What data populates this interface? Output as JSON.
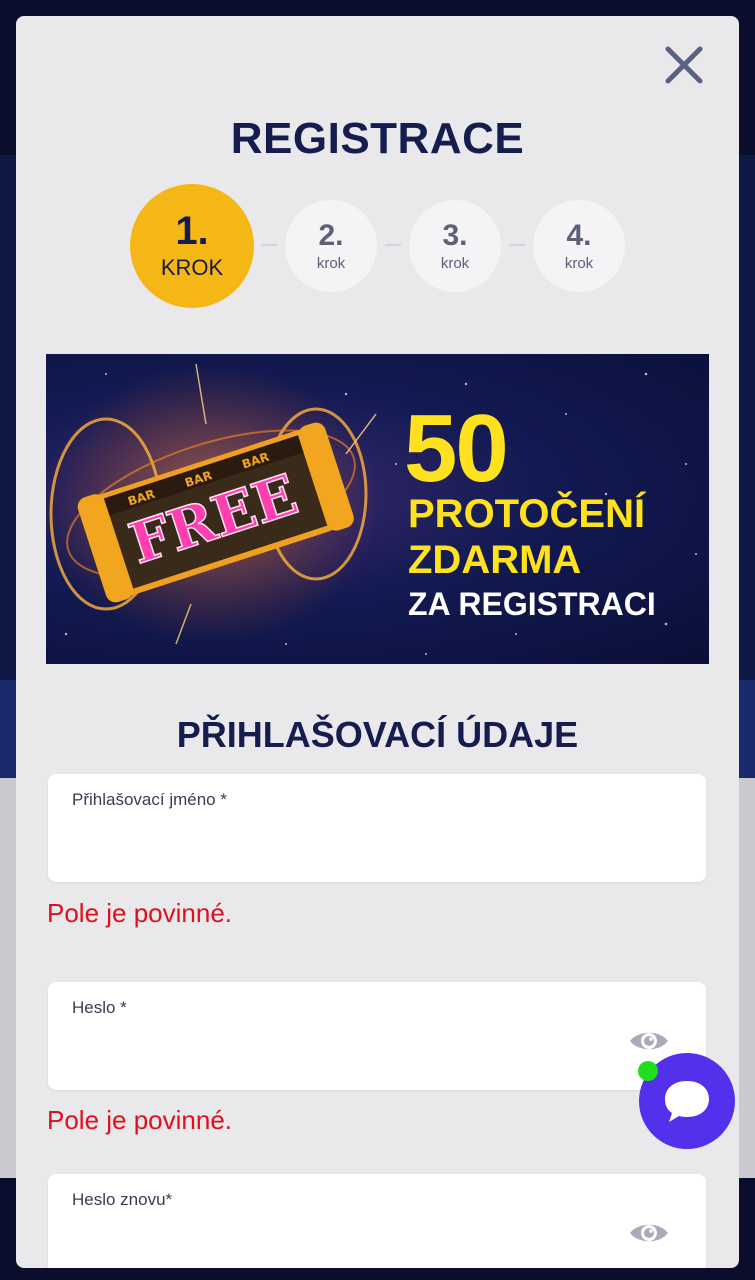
{
  "modal": {
    "title": "REGISTRACE",
    "close_icon": "close-icon"
  },
  "steps": [
    {
      "num": "1.",
      "label": "KROK",
      "active": true
    },
    {
      "num": "2.",
      "label": "krok",
      "active": false
    },
    {
      "num": "3.",
      "label": "krok",
      "active": false
    },
    {
      "num": "4.",
      "label": "krok",
      "active": false
    }
  ],
  "banner": {
    "amount": "50",
    "line1": "PROTOČENÍ",
    "line2": "ZDARMA",
    "line3": "ZA REGISTRACI",
    "reel_text": "FREE",
    "reel_symbol": "BAR"
  },
  "form": {
    "section_title": "PŘIHLAŠOVACÍ ÚDAJE",
    "username_label": "Přihlašovací jméno *",
    "username_value": "",
    "username_error": "Pole je povinné.",
    "password_label": "Heslo *",
    "password_value": "",
    "password_error": "Pole je povinné.",
    "password_repeat_label": "Heslo znovu*",
    "password_repeat_value": "",
    "eye_icon": "eye-icon"
  },
  "chat": {
    "icon": "chat-bubble-icon",
    "status_color": "#20e01e"
  },
  "colors": {
    "accent_yellow": "#f5b716",
    "navy": "#151c4e",
    "error_red": "#e00f1d",
    "chat_purple": "#5330ec"
  }
}
